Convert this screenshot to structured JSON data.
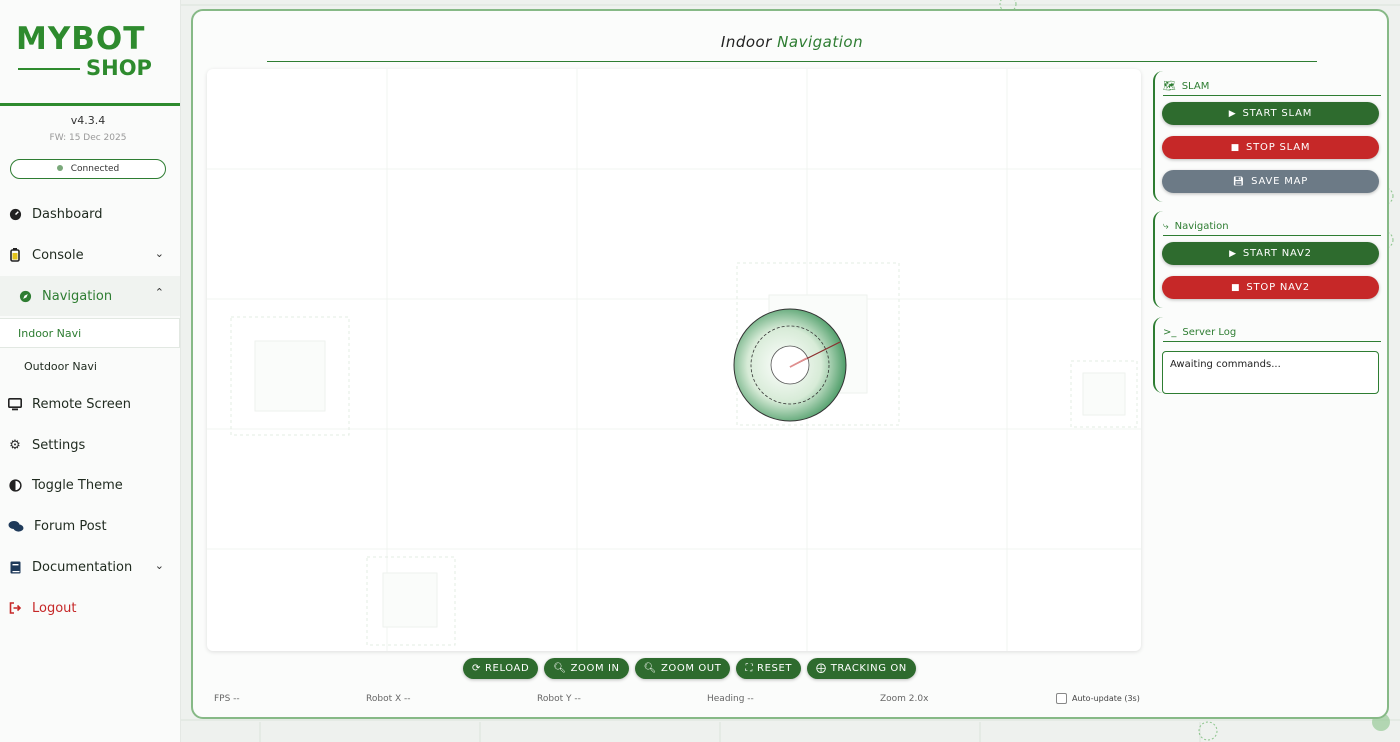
{
  "sidebar": {
    "logo_top": "MYBOT",
    "logo_bottom": "SHOP",
    "version": "v4.3.4",
    "firmware": "FW: 15 Dec 2025",
    "connection_status": "Connected",
    "items": [
      {
        "label": "Dashboard",
        "icon": "tachometer-icon"
      },
      {
        "label": "Console",
        "icon": "battery-icon"
      },
      {
        "label": "Navigation",
        "icon": "compass-icon"
      },
      {
        "label": "Remote Screen",
        "icon": "monitor-icon"
      },
      {
        "label": "Settings",
        "icon": "gear-icon"
      },
      {
        "label": "Toggle Theme",
        "icon": "half-circle-icon"
      },
      {
        "label": "Forum Post",
        "icon": "comments-icon"
      },
      {
        "label": "Documentation",
        "icon": "book-icon"
      },
      {
        "label": "Logout",
        "icon": "sign-out-icon"
      }
    ],
    "sub_items": [
      {
        "label": "Indoor Navi"
      },
      {
        "label": "Outdoor Navi"
      }
    ]
  },
  "main": {
    "title_prefix": "Indoor",
    "title_accent": "Navigation",
    "controls": [
      "RELOAD",
      "ZOOM IN",
      "ZOOM OUT",
      "RESET",
      "TRACKING ON"
    ],
    "stats": {
      "fps": "FPS --",
      "robot_x": "Robot X --",
      "robot_y": "Robot Y --",
      "heading": "Heading --",
      "zoom": "Zoom 2.0x"
    },
    "auto_update_label": "Auto-update (3s)"
  },
  "slam": {
    "title": "SLAM",
    "start": "START SLAM",
    "stop": "STOP SLAM",
    "save": "SAVE MAP"
  },
  "navigation_panel": {
    "title": "Navigation",
    "start": "START NAV2",
    "stop": "STOP NAV2"
  },
  "server_log": {
    "title": "Server Log",
    "text": "Awaiting commands..."
  },
  "colors": {
    "brand": "#2e7d32",
    "button_green": "#2e6b2e",
    "button_red": "#c62828",
    "button_gray": "#6c7a86"
  }
}
